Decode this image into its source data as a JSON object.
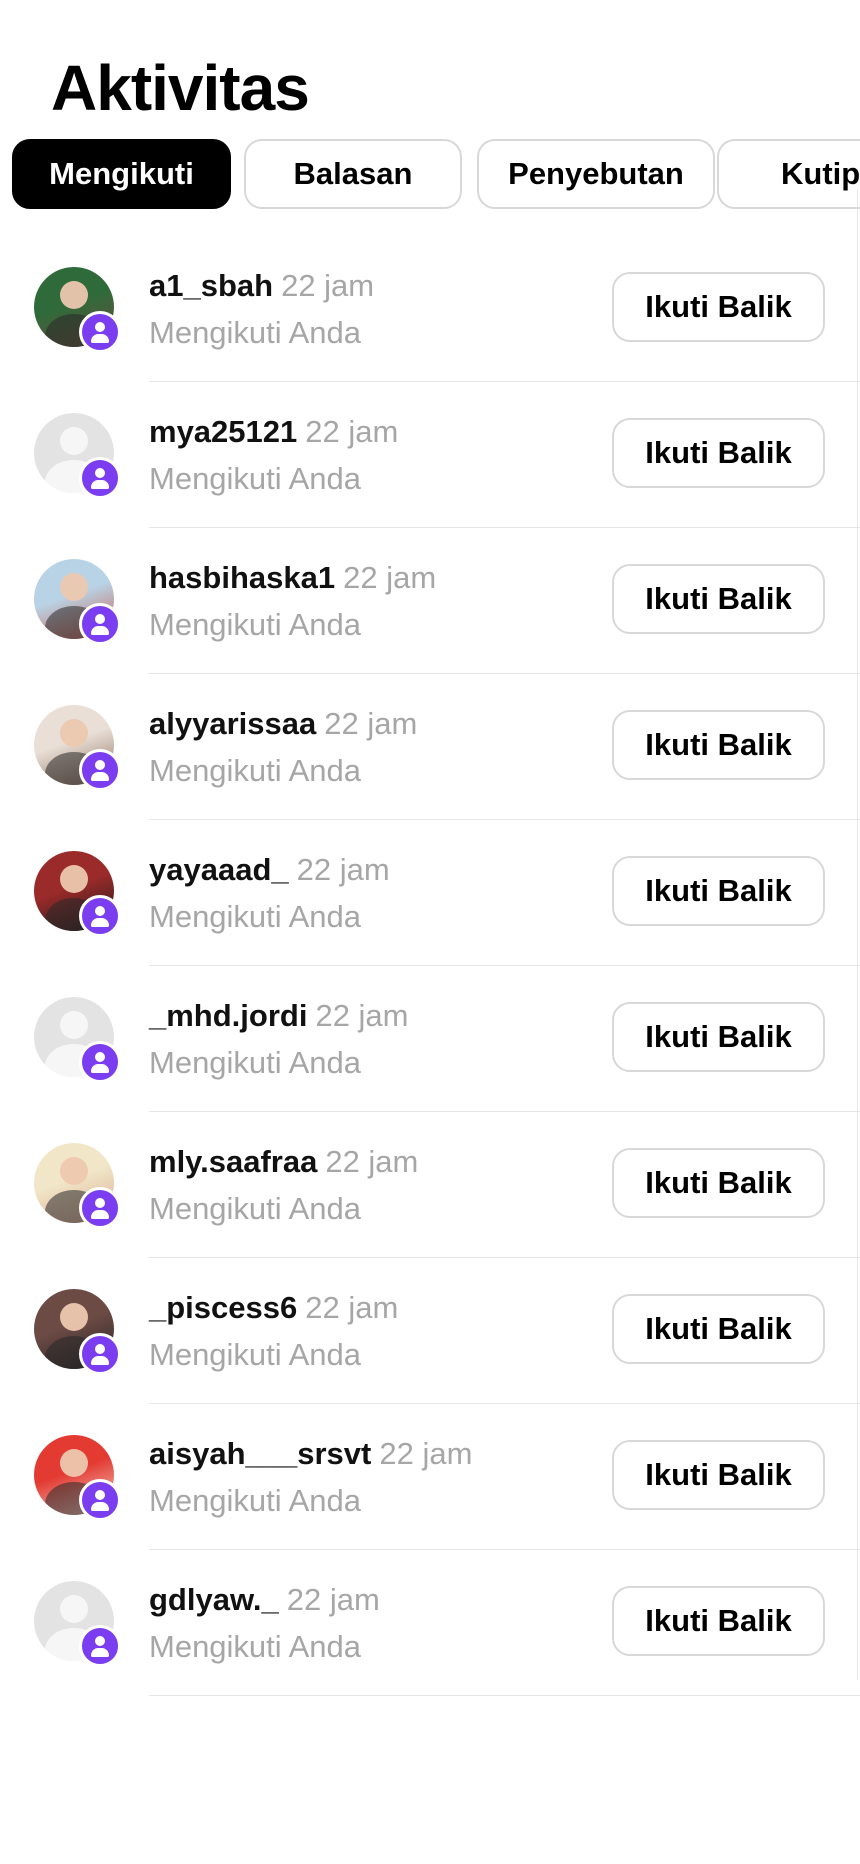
{
  "header": {
    "title": "Aktivitas"
  },
  "tabs": [
    {
      "label": "Mengikuti",
      "active": true
    },
    {
      "label": "Balasan",
      "active": false
    },
    {
      "label": "Penyebutan",
      "active": false
    },
    {
      "label": "Kutipa",
      "active": false
    }
  ],
  "activity": [
    {
      "username": "a1_sbah",
      "time": "22 jam",
      "subtitle": "Mengikuti Anda",
      "action": "Ikuti Balik",
      "avatar": "photo",
      "avatar_colors": [
        "#2f6b3a",
        "#6b4b3a"
      ]
    },
    {
      "username": "mya25121",
      "time": "22 jam",
      "subtitle": "Mengikuti Anda",
      "action": "Ikuti Balik",
      "avatar": "default-avatar-icon"
    },
    {
      "username": "hasbihaska1",
      "time": "22 jam",
      "subtitle": "Mengikuti Anda",
      "action": "Ikuti Balik",
      "avatar": "photo",
      "avatar_colors": [
        "#b9d3e6",
        "#c75a4a"
      ]
    },
    {
      "username": "alyyarissaa",
      "time": "22 jam",
      "subtitle": "Mengikuti Anda",
      "action": "Ikuti Balik",
      "avatar": "photo",
      "avatar_colors": [
        "#e9dfd6",
        "#8a6c5a"
      ]
    },
    {
      "username": "yayaaad_",
      "time": "22 jam",
      "subtitle": "Mengikuti Anda",
      "action": "Ikuti Balik",
      "avatar": "photo",
      "avatar_colors": [
        "#9b2a2a",
        "#1a1a1a"
      ]
    },
    {
      "username": "_mhd.jordi",
      "time": "22 jam",
      "subtitle": "Mengikuti Anda",
      "action": "Ikuti Balik",
      "avatar": "default-avatar-icon"
    },
    {
      "username": "mly.saafraa",
      "time": "22 jam",
      "subtitle": "Mengikuti Anda",
      "action": "Ikuti Balik",
      "avatar": "photo",
      "avatar_colors": [
        "#f1e6c8",
        "#d9a88f"
      ]
    },
    {
      "username": "_piscess6",
      "time": "22 jam",
      "subtitle": "Mengikuti Anda",
      "action": "Ikuti Balik",
      "avatar": "photo",
      "avatar_colors": [
        "#6d4b45",
        "#222222"
      ]
    },
    {
      "username": "aisyah___srsvt",
      "time": "22 jam",
      "subtitle": "Mengikuti Anda",
      "action": "Ikuti Balik",
      "avatar": "photo",
      "avatar_colors": [
        "#e33a32",
        "#f3d6cc"
      ]
    },
    {
      "username": "gdlyaw._",
      "time": "22 jam",
      "subtitle": "Mengikuti Anda",
      "action": "Ikuti Balik",
      "avatar": "default-avatar-icon"
    }
  ],
  "colors": {
    "badge": "#7b3df0",
    "muted_text": "#a6a6a6",
    "border": "#d8d8d8",
    "active_tab_bg": "#000000"
  }
}
